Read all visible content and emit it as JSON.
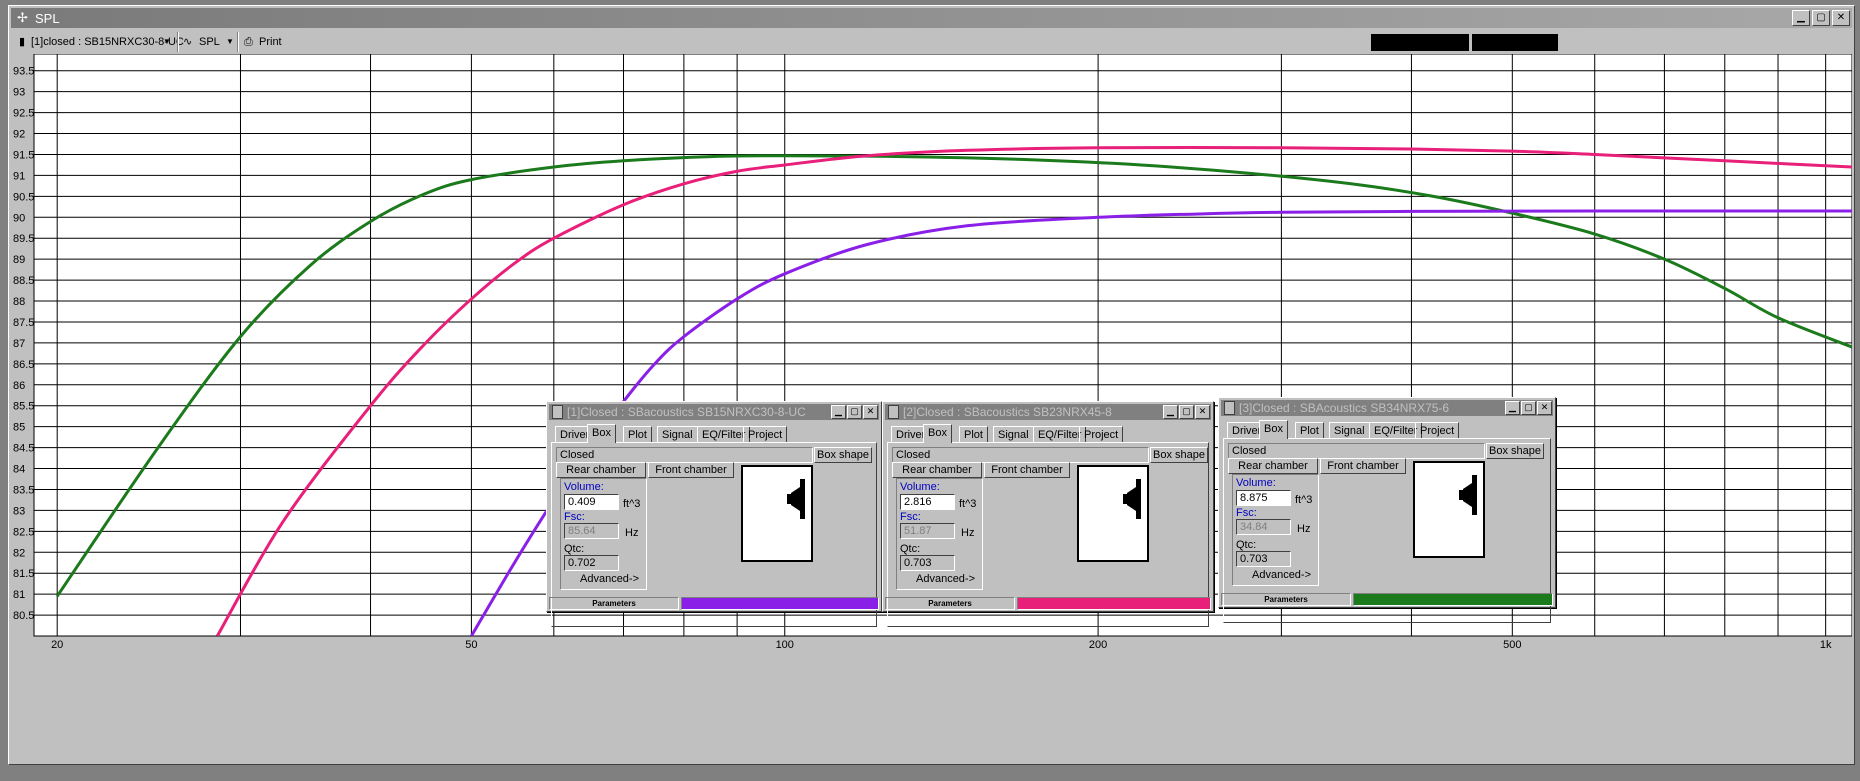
{
  "window": {
    "title": "SPL"
  },
  "toolbar": {
    "project_selector": "[1]closed : SB15NRXC30-8-UC",
    "plot_selector": "SPL",
    "print_label": "Print"
  },
  "chart_data": {
    "type": "line",
    "x_scale": "log",
    "xlim": [
      19,
      1060
    ],
    "ylim": [
      80,
      93.9
    ],
    "y_ticks": [
      80.5,
      81,
      81.5,
      82,
      82.5,
      83,
      83.5,
      84,
      84.5,
      85,
      85.5,
      86,
      86.5,
      87,
      87.5,
      88,
      88.5,
      89,
      89.5,
      90,
      90.5,
      91,
      91.5,
      92,
      92.5,
      93,
      93.5
    ],
    "x_tick_labels": [
      {
        "value": 20,
        "label": "20"
      },
      {
        "value": 50,
        "label": "50"
      },
      {
        "value": 100,
        "label": "100"
      },
      {
        "value": 200,
        "label": "200"
      },
      {
        "value": 500,
        "label": "500"
      },
      {
        "value": 1000,
        "label": "1k"
      }
    ],
    "x_grid": [
      20,
      30,
      40,
      50,
      60,
      70,
      80,
      90,
      100,
      200,
      300,
      400,
      500,
      600,
      700,
      800,
      900,
      1000
    ],
    "grid": true,
    "series": [
      {
        "color": "#1b7a1b",
        "points": [
          [
            20,
            80.95
          ],
          [
            25,
            84.5
          ],
          [
            30,
            87.15
          ],
          [
            35,
            88.85
          ],
          [
            40,
            89.9
          ],
          [
            45,
            90.55
          ],
          [
            50,
            90.9
          ],
          [
            60,
            91.2
          ],
          [
            70,
            91.35
          ],
          [
            85,
            91.45
          ],
          [
            100,
            91.47
          ],
          [
            130,
            91.45
          ],
          [
            170,
            91.38
          ],
          [
            220,
            91.25
          ],
          [
            280,
            91.05
          ],
          [
            350,
            90.8
          ],
          [
            420,
            90.5
          ],
          [
            500,
            90.1
          ],
          [
            600,
            89.6
          ],
          [
            700,
            89.0
          ],
          [
            800,
            88.3
          ],
          [
            900,
            87.6
          ],
          [
            1060,
            86.9
          ]
        ]
      },
      {
        "color": "#e8207a",
        "points": [
          [
            28.5,
            80.0
          ],
          [
            33,
            82.75
          ],
          [
            40,
            85.5
          ],
          [
            45,
            86.95
          ],
          [
            50,
            88.05
          ],
          [
            55,
            88.9
          ],
          [
            60,
            89.5
          ],
          [
            70,
            90.3
          ],
          [
            80,
            90.8
          ],
          [
            90,
            91.1
          ],
          [
            100,
            91.25
          ],
          [
            120,
            91.47
          ],
          [
            150,
            91.6
          ],
          [
            200,
            91.66
          ],
          [
            300,
            91.66
          ],
          [
            400,
            91.63
          ],
          [
            500,
            91.58
          ],
          [
            600,
            91.5
          ],
          [
            700,
            91.42
          ],
          [
            800,
            91.35
          ],
          [
            1060,
            91.2
          ]
        ]
      },
      {
        "color": "#8a20e8",
        "points": [
          [
            50,
            80.0
          ],
          [
            55,
            81.75
          ],
          [
            60,
            83.25
          ],
          [
            65,
            84.5
          ],
          [
            70,
            85.6
          ],
          [
            75,
            86.5
          ],
          [
            80,
            87.15
          ],
          [
            90,
            88.05
          ],
          [
            100,
            88.65
          ],
          [
            120,
            89.35
          ],
          [
            150,
            89.8
          ],
          [
            200,
            90.0
          ],
          [
            250,
            90.08
          ],
          [
            300,
            90.12
          ],
          [
            400,
            90.14
          ],
          [
            600,
            90.15
          ],
          [
            1060,
            90.15
          ]
        ]
      }
    ]
  },
  "tabs": [
    "Driver",
    "Box",
    "Plot",
    "Signal",
    "EQ/Filter",
    "Project"
  ],
  "labels": {
    "box_shape": "Box shape",
    "rear_chamber": "Rear chamber",
    "front_chamber": "Front chamber",
    "volume": "Volume:",
    "fsc": "Fsc:",
    "qtc": "Qtc:",
    "advanced": "Advanced->",
    "unit_volume": "ft^3",
    "unit_hz": "Hz",
    "parameters": "Parameters"
  },
  "boxes": [
    {
      "title": "[1]Closed : SBacoustics SB15NRXC30-8-UC",
      "box_type": "Closed",
      "volume": "0.409",
      "fsc": "85.64",
      "qtc": "0.702",
      "color": "#8a20e8"
    },
    {
      "title": "[2]Closed : SBacoustics SB23NRX45-8",
      "box_type": "Closed",
      "volume": "2.816",
      "fsc": "51.87",
      "qtc": "0.703",
      "color": "#e8207a"
    },
    {
      "title": "[3]Closed : SBAcoustics SB34NRX75-6",
      "box_type": "Closed",
      "volume": "8.875",
      "fsc": "34.84",
      "qtc": "0.703",
      "color": "#1b7a1b"
    }
  ]
}
